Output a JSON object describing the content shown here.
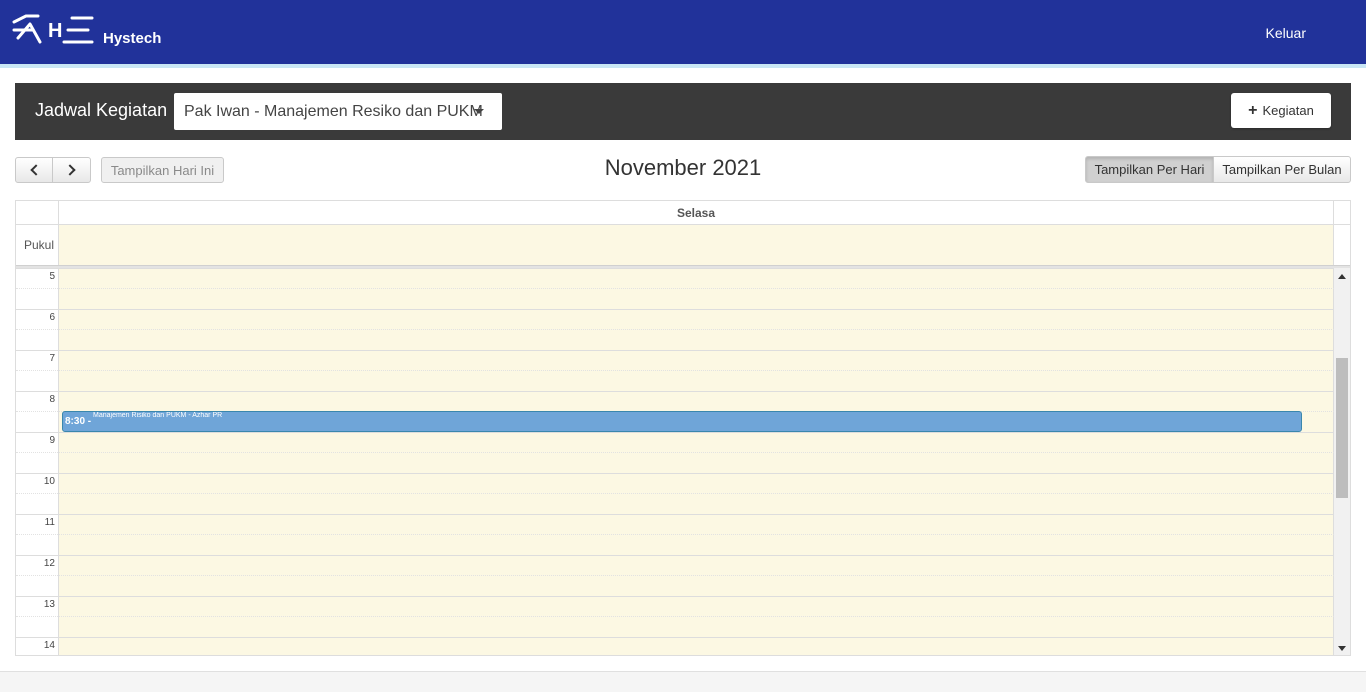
{
  "navbar": {
    "brand": "Hystech",
    "logout_label": "Keluar",
    "logo_icon": "hystech-logo",
    "background_color": "#21329a"
  },
  "panel": {
    "title": "Jadwal Kegiatan",
    "select_value": "Pak Iwan - Manajemen Resiko dan PUKM",
    "add_button_label": "Kegiatan",
    "add_button_icon": "plus-icon"
  },
  "toolbar": {
    "prev_icon": "chevron-left-icon",
    "next_icon": "chevron-right-icon",
    "today_label": "Tampilkan Hari Ini",
    "title": "November 2021",
    "day_view_label": "Tampilkan Per Hari",
    "month_view_label": "Tampilkan Per Bulan",
    "active_view": "day"
  },
  "calendar": {
    "day_header": "Selasa",
    "allday_label": "Pukul",
    "hours": [
      "5",
      "6",
      "7",
      "8",
      "9",
      "10",
      "11",
      "12",
      "13",
      "14"
    ],
    "events": [
      {
        "time": "8:30 -",
        "title": "Manajemen Risiko dan PUKM - Azhar PR",
        "color": "#6fa5d8"
      }
    ],
    "background_color": "#fcf8e3"
  }
}
